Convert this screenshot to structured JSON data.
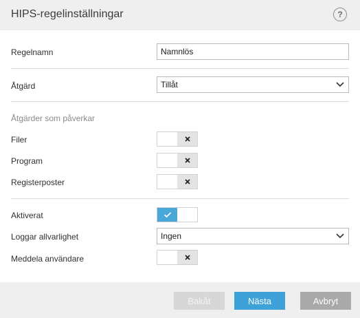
{
  "window": {
    "title": "HIPS-regelinställningar",
    "help_glyph": "?"
  },
  "rule_name": {
    "label": "Regelnamn",
    "value": "Namnlös"
  },
  "action": {
    "label": "Åtgärd",
    "selected": "Tillåt"
  },
  "affecting": {
    "heading": "Åtgärder som påverkar",
    "items": [
      {
        "label": "Filer",
        "enabled": false
      },
      {
        "label": "Program",
        "enabled": false
      },
      {
        "label": "Registerposter",
        "enabled": false
      }
    ]
  },
  "enabled": {
    "label": "Aktiverat",
    "enabled": true
  },
  "log_severity": {
    "label": "Loggar allvarlighet",
    "selected": "Ingen"
  },
  "notify_user": {
    "label": "Meddela användare",
    "enabled": false
  },
  "buttons": {
    "back": "Bakåt",
    "next": "Nästa",
    "cancel": "Avbryt"
  },
  "colors": {
    "accent": "#3ea1d8",
    "toggle_on": "#49a6d9",
    "toggle_off": "#e3e3e3"
  }
}
